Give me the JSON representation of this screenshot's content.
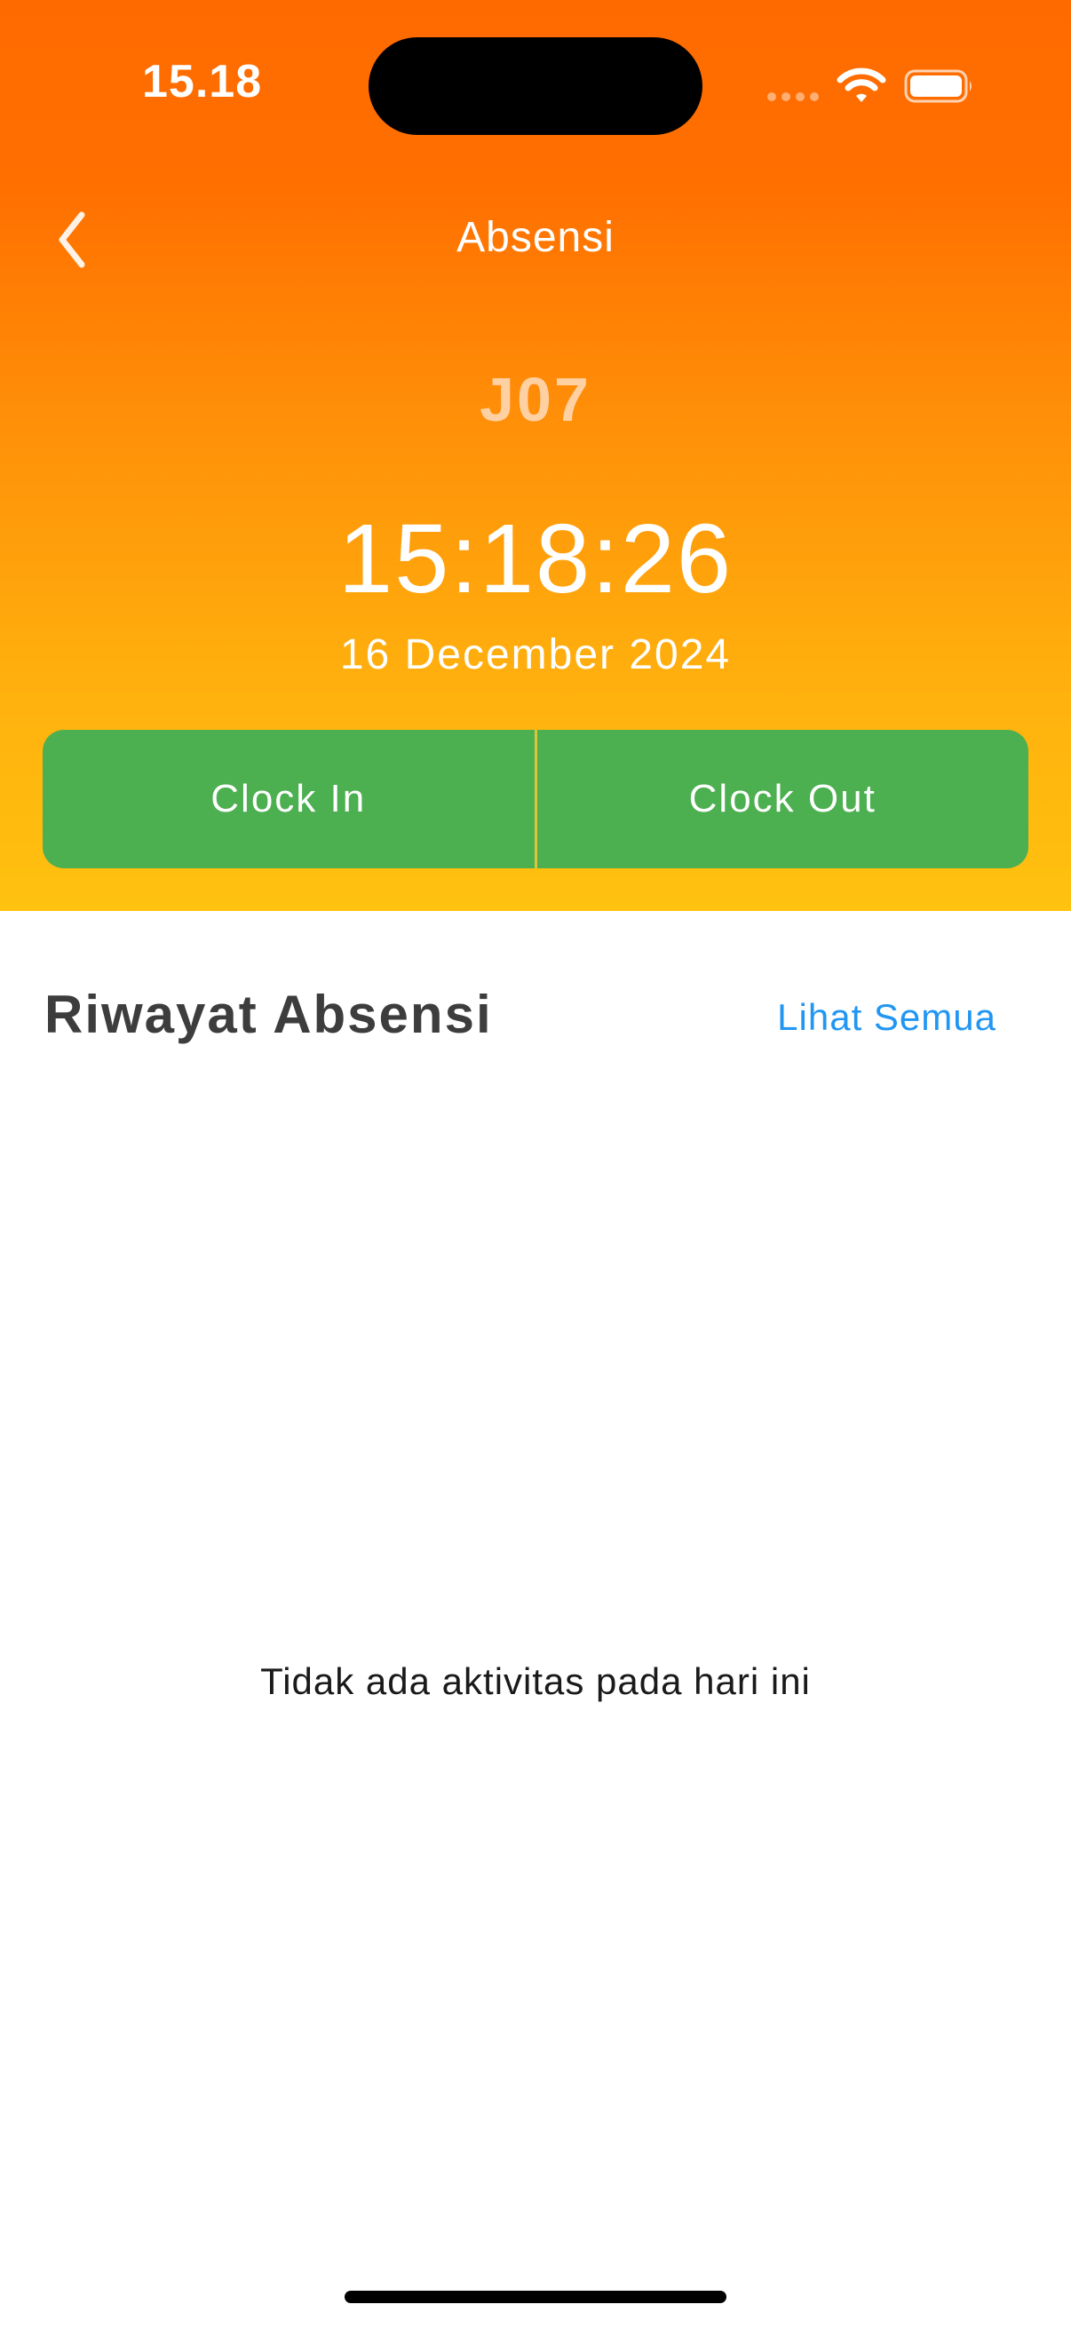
{
  "status_bar": {
    "time": "15.18"
  },
  "header": {
    "title": "Absensi",
    "code": "J07",
    "clock": "15:18:26",
    "date": "16 December 2024"
  },
  "actions": {
    "clock_in_label": "Clock In",
    "clock_out_label": "Clock Out"
  },
  "history": {
    "title": "Riwayat Absensi",
    "see_all_label": "Lihat Semua",
    "empty_message": "Tidak ada aktivitas pada hari ini"
  },
  "icons": {
    "back": "chevron-left-icon",
    "wifi": "wifi-icon",
    "battery": "battery-icon",
    "signal": "cellular-signal-icon"
  },
  "colors": {
    "header_gradient_top": "#ff6a00",
    "header_gradient_bottom": "#ffc20f",
    "clock_button": "#4caf50",
    "link": "#2196f3",
    "code_text": "#ffd0a2"
  }
}
